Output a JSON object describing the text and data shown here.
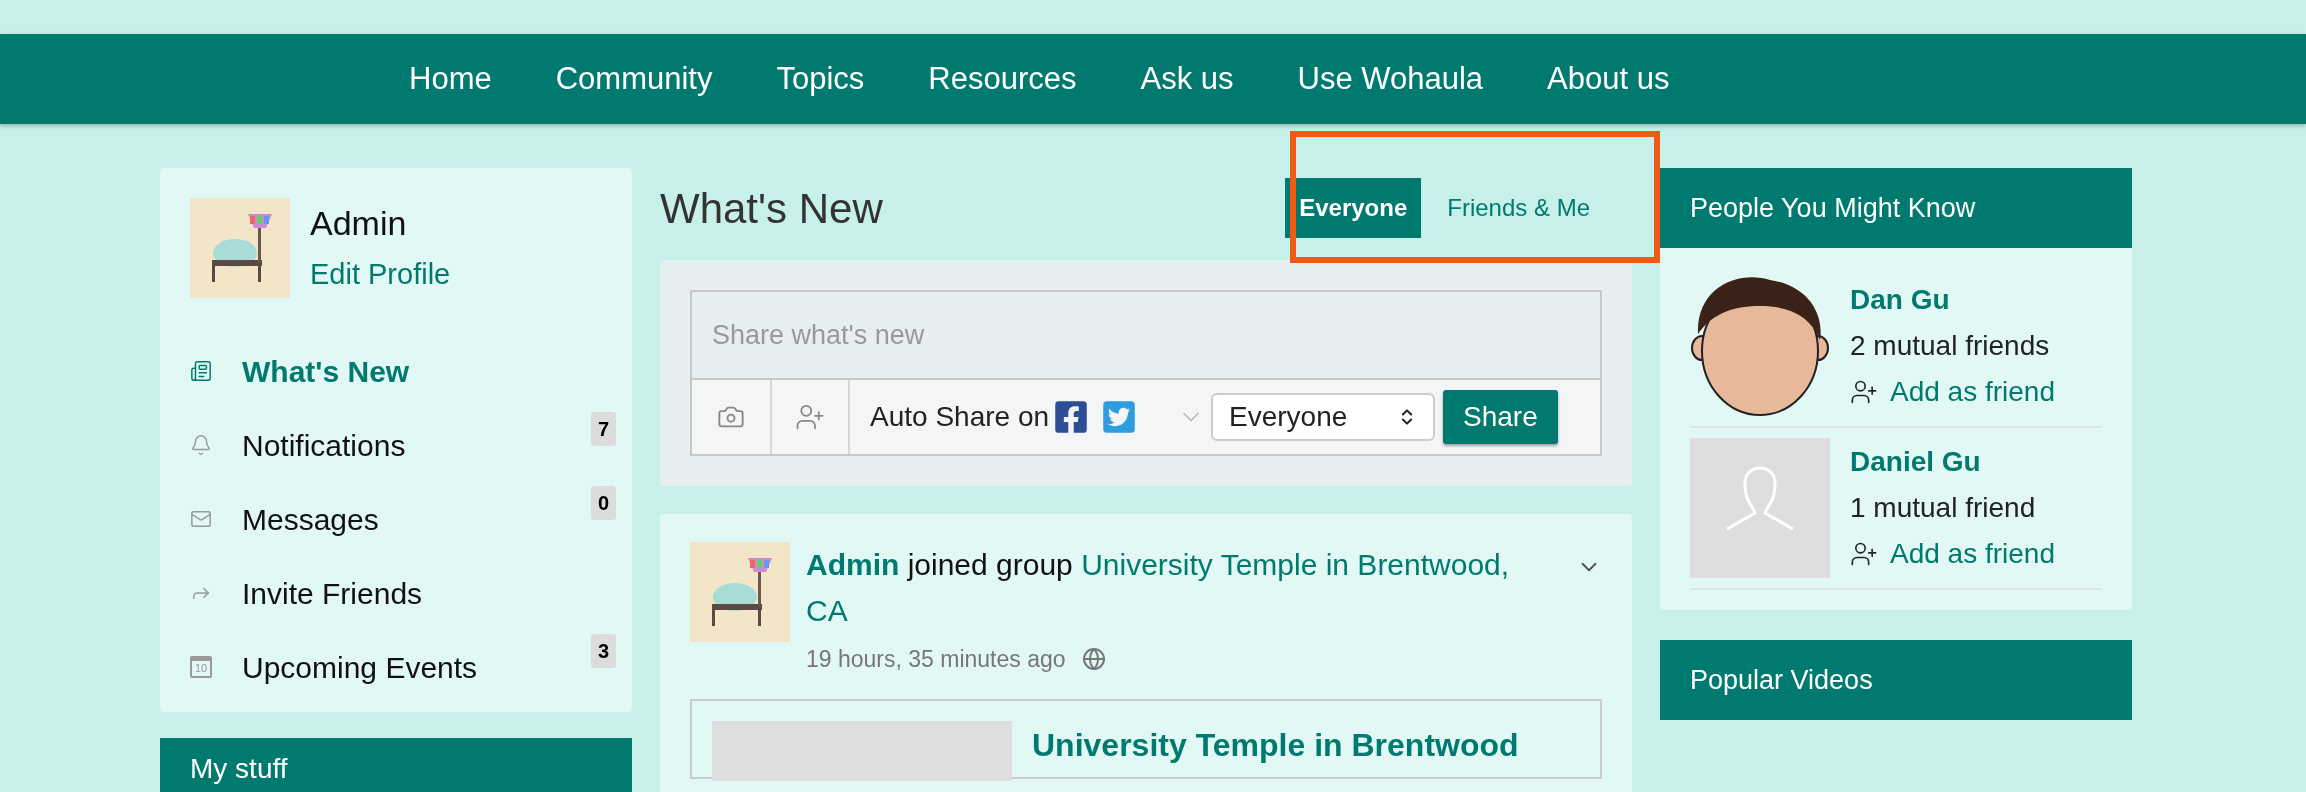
{
  "nav": {
    "items": [
      {
        "label": "Home"
      },
      {
        "label": "Community"
      },
      {
        "label": "Topics"
      },
      {
        "label": "Resources"
      },
      {
        "label": "Ask us"
      },
      {
        "label": "Use Wohaula"
      },
      {
        "label": "About us"
      }
    ]
  },
  "profile": {
    "name": "Admin",
    "edit_link": "Edit Profile"
  },
  "sidebar": {
    "items": [
      {
        "label": "What's New",
        "selected": true
      },
      {
        "label": "Notifications",
        "badge": "7",
        "selected": false
      },
      {
        "label": "Messages",
        "badge": "0",
        "selected": false
      },
      {
        "label": "Invite Friends",
        "selected": false
      },
      {
        "label": "Upcoming Events",
        "badge": "3",
        "calendar_day": "10",
        "selected": false
      }
    ]
  },
  "my_stuff": {
    "title": "My stuff"
  },
  "feed": {
    "title": "What's New",
    "filters": [
      {
        "label": "Everyone",
        "selected": true
      },
      {
        "label": "Friends & Me",
        "selected": false
      }
    ],
    "composer": {
      "placeholder": "Share what's new",
      "auto_share_label": "Auto Share on",
      "audience": "Everyone",
      "share_button": "Share"
    },
    "activity": {
      "actor": "Admin",
      "action": "joined group",
      "target": "University Temple in Brentwood, CA",
      "time": "19 hours, 35 minutes ago"
    },
    "link_card": {
      "title": "University Temple in Brentwood"
    }
  },
  "people_you_might_know": {
    "title": "People You Might Know",
    "people": [
      {
        "name": "Dan Gu",
        "mutual": "2 mutual friends",
        "action": "Add as friend",
        "kind": "cartoon"
      },
      {
        "name": "Daniel Gu",
        "mutual": "1 mutual friend",
        "action": "Add as friend",
        "kind": "placeholder"
      }
    ]
  },
  "popular_videos": {
    "title": "Popular Videos"
  }
}
